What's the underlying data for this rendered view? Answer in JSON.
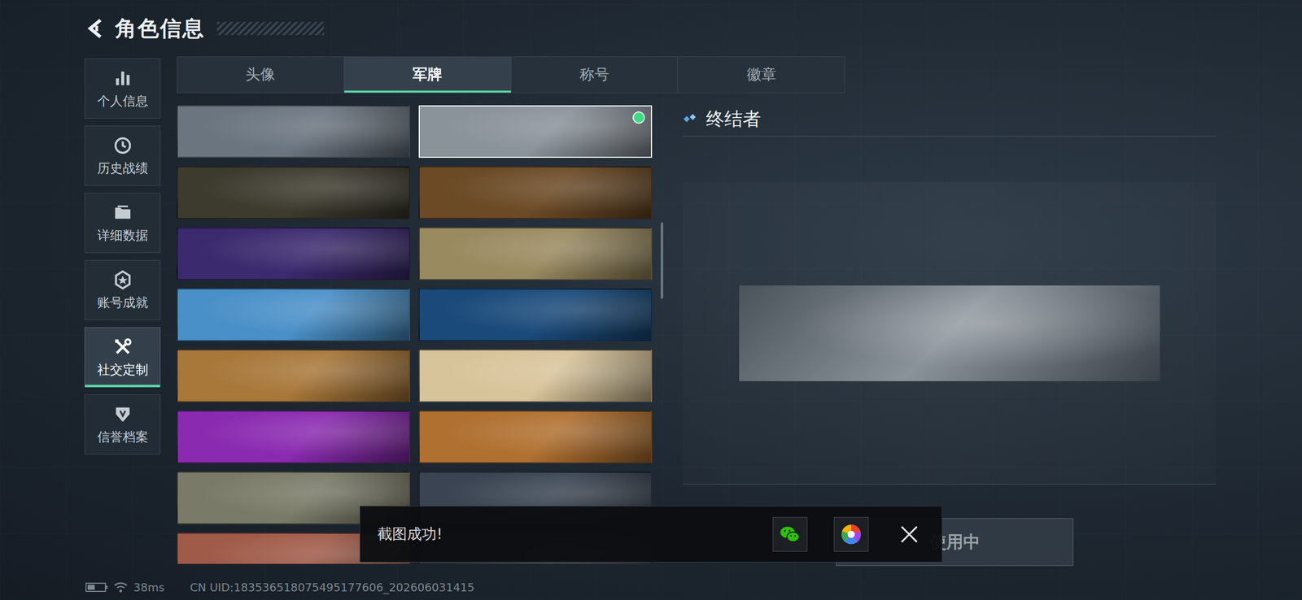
{
  "header": {
    "title": "角色信息"
  },
  "sidebar": {
    "items": [
      {
        "label": "个人信息",
        "selected": false
      },
      {
        "label": "历史战绩",
        "selected": false
      },
      {
        "label": "详细数据",
        "selected": false
      },
      {
        "label": "账号成就",
        "selected": false
      },
      {
        "label": "社交定制",
        "selected": true
      },
      {
        "label": "信誉档案",
        "selected": false
      }
    ]
  },
  "tabs": [
    {
      "label": "头像",
      "selected": false
    },
    {
      "label": "军牌",
      "selected": true
    },
    {
      "label": "称号",
      "selected": false
    },
    {
      "label": "徽章",
      "selected": false
    }
  ],
  "thumbnails": [
    {
      "color": "#6b7580",
      "selected": false,
      "equipped": false
    },
    {
      "color": "#8a929a",
      "selected": true,
      "equipped": true
    },
    {
      "color": "#3d3a2e",
      "selected": false,
      "equipped": false
    },
    {
      "color": "#6b4a25",
      "selected": false,
      "equipped": false
    },
    {
      "color": "#3b2a6e",
      "selected": false,
      "equipped": false
    },
    {
      "color": "#9a8a60",
      "selected": false,
      "equipped": false
    },
    {
      "color": "#4a90c8",
      "selected": false,
      "equipped": false
    },
    {
      "color": "#1a4a7a",
      "selected": false,
      "equipped": false
    },
    {
      "color": "#a8773a",
      "selected": false,
      "equipped": false
    },
    {
      "color": "#d8c49a",
      "selected": false,
      "equipped": false
    },
    {
      "color": "#8a2ab0",
      "selected": false,
      "equipped": false
    },
    {
      "color": "#b07030",
      "selected": false,
      "equipped": false
    },
    {
      "color": "#7a7a68",
      "selected": false,
      "equipped": false
    },
    {
      "color": "#3a4452",
      "selected": false,
      "equipped": false
    },
    {
      "color": "#a05a48",
      "selected": false,
      "equipped": false
    },
    {
      "color": "#2a3038",
      "selected": false,
      "equipped": false
    }
  ],
  "detail": {
    "title": "终结者",
    "button": "使用中"
  },
  "toast": {
    "message": "截图成功!"
  },
  "status_bar": {
    "ping": "38ms",
    "uid": "CN UID:183536518075495177606_202606031415"
  }
}
